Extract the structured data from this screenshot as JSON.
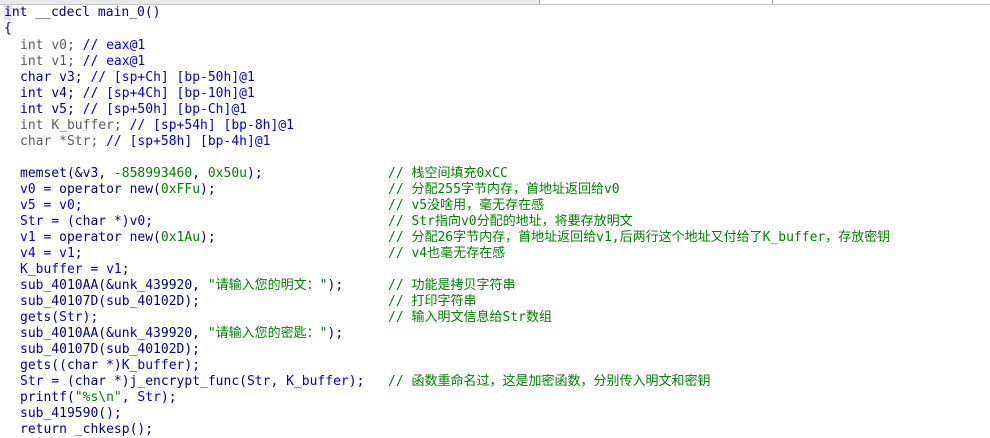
{
  "header": "int __cdecl main_0()",
  "open_brace": "{",
  "decls": [
    {
      "type": "int",
      "name": "v0;",
      "comment": "// eax@1"
    },
    {
      "type": "int",
      "name": "v1;",
      "comment": "// eax@1"
    },
    {
      "type": "char",
      "name": "v3;",
      "comment": "// [sp+Ch] [bp-50h]@1"
    },
    {
      "type": "int",
      "name": "v4;",
      "comment": "// [sp+4Ch] [bp-10h]@1"
    },
    {
      "type": "int",
      "name": "v5;",
      "comment": "// [sp+50h] [bp-Ch]@1"
    },
    {
      "type": "int",
      "name": "K_buffer;",
      "comment": "// [sp+54h] [bp-8h]@1"
    },
    {
      "type": "char *",
      "name": "Str;",
      "comment": "// [sp+58h] [bp-4h]@1"
    }
  ],
  "code": {
    "l1": {
      "a": "memset(&v3, ",
      "n1": "-858993460",
      "b": ", ",
      "n2": "0x50u",
      "c": ");",
      "cmt": "// 栈空间填充0xCC"
    },
    "l2": {
      "v": "v0",
      "a": " = operator new(",
      "n": "0xFFu",
      "b": ");",
      "cmt": "// 分配255字节内存，首地址返回给v0"
    },
    "l3": {
      "v": "v5",
      "a": " = ",
      "v2": "v0",
      "b": ";",
      "cmt": "// v5没啥用，毫无存在感"
    },
    "l4": {
      "v": "Str",
      "a": " = (char *)",
      "v2": "v0",
      "b": ";",
      "cmt": "// Str指向v0分配的地址，将要存放明文"
    },
    "l5": {
      "v": "v1",
      "a": " = operator new(",
      "n": "0x1Au",
      "b": ");",
      "cmt": "// 分配26字节内存，首地址返回给v1,后两行这个地址又付给了K_buffer，存放密钥"
    },
    "l6": {
      "v": "v4",
      "a": " = ",
      "v2": "v1",
      "b": ";",
      "cmt": "// v4也毫无存在感"
    },
    "l7": {
      "v": "K_buffer",
      "a": " = ",
      "v2": "v1",
      "b": ";"
    },
    "l8": {
      "a": "sub_4010AA(&unk_439920, ",
      "s": "\"请输入您的明文：\"",
      "b": ");",
      "cmt": "// 功能是拷贝字符串"
    },
    "l9": {
      "a": "sub_40107D(sub_40102D);",
      "cmt": "// 打印字符串"
    },
    "l10": {
      "a": "gets(",
      "v": "Str",
      "b": ");",
      "cmt": "// 输入明文信息给Str数组"
    },
    "l11": {
      "a": "sub_4010AA(&unk_439920, ",
      "s": "\"请输入您的密匙：\"",
      "b": ");"
    },
    "l12": {
      "a": "sub_40107D(sub_40102D);"
    },
    "l13": {
      "a": "gets((char *)",
      "v": "K_buffer",
      "b": ");"
    },
    "l14": {
      "v": "Str",
      "a": " = (char *)j_encrypt_func(",
      "v2": "Str",
      "b": ", ",
      "v3": "K_buffer",
      "c": ");",
      "cmt": "// 函数重命名过，这是加密函数，分别传入明文和密钥"
    },
    "l15": {
      "a": "printf(",
      "s": "\"%s\\n\"",
      "b": ", ",
      "v": "Str",
      "c": ");"
    },
    "l16": {
      "a": "sub_419590();"
    },
    "l17": {
      "a": "return _chkesp();"
    }
  }
}
